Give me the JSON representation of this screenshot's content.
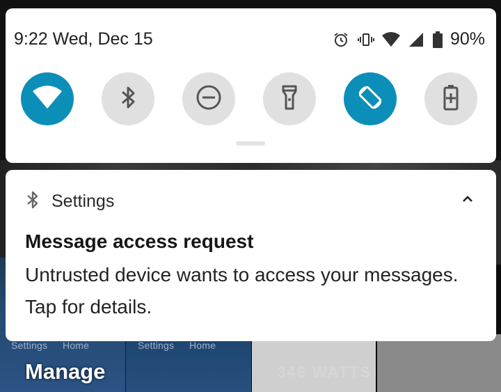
{
  "status_bar": {
    "time_date": "9:22 Wed, Dec 15",
    "battery_percent": "90%",
    "icons": [
      "alarm-icon",
      "vibrate-icon",
      "wifi-icon",
      "cellular-signal-icon",
      "battery-icon"
    ]
  },
  "quick_settings": {
    "tiles": [
      {
        "name": "wifi",
        "icon": "wifi-icon",
        "active": true
      },
      {
        "name": "bluetooth",
        "icon": "bluetooth-icon",
        "active": false
      },
      {
        "name": "do-not-disturb",
        "icon": "do-not-disturb-icon",
        "active": false
      },
      {
        "name": "flashlight",
        "icon": "flashlight-icon",
        "active": false
      },
      {
        "name": "auto-rotate",
        "icon": "auto-rotate-icon",
        "active": true
      },
      {
        "name": "battery-saver",
        "icon": "battery-saver-icon",
        "active": false
      }
    ],
    "colors": {
      "active": "#0b8fb8",
      "inactive": "#e0e0e0"
    }
  },
  "notification": {
    "app_icon": "bluetooth-icon",
    "app_name": "Settings",
    "title": "Message access request",
    "body": "Untrusted device wants to access your messages. Tap for details."
  },
  "background": {
    "thumb_labels": [
      "Settings",
      "Home",
      "Settings",
      "Home"
    ],
    "watts_text": "346 WATTS",
    "manage_label": "Manage"
  }
}
